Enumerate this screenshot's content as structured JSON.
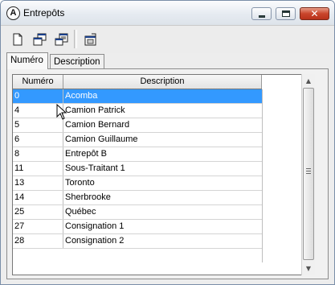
{
  "window": {
    "title": "Entrepôts",
    "app_icon": "A"
  },
  "toolbar": {
    "buttons": [
      "new-document-icon",
      "copy-windows-icon",
      "properties-list-icon",
      "export-window-icon"
    ]
  },
  "tabs": [
    {
      "label": "Numéro",
      "active": true
    },
    {
      "label": "Description",
      "active": false
    }
  ],
  "table": {
    "columns": [
      "Numéro",
      "Description"
    ],
    "rows": [
      {
        "numero": "0",
        "description": "Acomba",
        "selected": true
      },
      {
        "numero": "4",
        "description": "Camion Patrick"
      },
      {
        "numero": "5",
        "description": "Camion Bernard"
      },
      {
        "numero": "6",
        "description": "Camion Guillaume"
      },
      {
        "numero": "8",
        "description": "Entrepôt B"
      },
      {
        "numero": "11",
        "description": "Sous-Traitant 1"
      },
      {
        "numero": "13",
        "description": "Toronto"
      },
      {
        "numero": "14",
        "description": "Sherbrooke"
      },
      {
        "numero": "25",
        "description": "Québec"
      },
      {
        "numero": "27",
        "description": "Consignation 1"
      },
      {
        "numero": "28",
        "description": "Consignation 2"
      }
    ]
  },
  "colors": {
    "selection": "#3399ff",
    "close_button": "#c9452b"
  }
}
